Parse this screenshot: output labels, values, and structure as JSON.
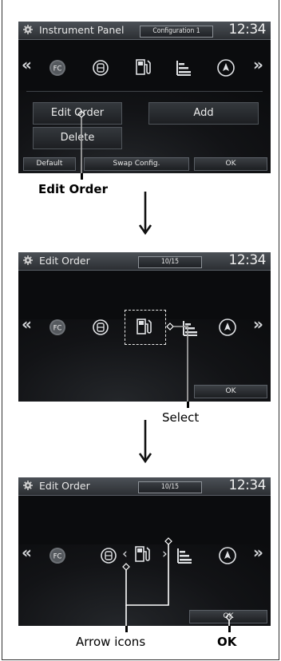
{
  "steps": [
    {
      "screen": {
        "title": "Instrument Panel",
        "config": "Configuration 1",
        "clock": "12:34",
        "buttons": {
          "edit_order": "Edit Order",
          "add": "Add",
          "delete": "Delete",
          "default": "Default",
          "swap": "Swap Config.",
          "ok": "OK"
        },
        "icons": [
          "fuel-economy-icon",
          "tpms-icon",
          "fuel-pump-icon",
          "bar-graph-icon",
          "compass-icon"
        ],
        "fc_label": "FC"
      },
      "caption": "Edit Order"
    },
    {
      "screen": {
        "title": "Edit Order",
        "counter": "10/15",
        "clock": "12:34",
        "ok": "OK",
        "fc_label": "FC"
      },
      "caption": "Select"
    },
    {
      "screen": {
        "title": "Edit Order",
        "counter": "10/15",
        "clock": "12:34",
        "ok": "OK",
        "fc_label": "FC"
      },
      "captions": {
        "arrows": "Arrow icons",
        "ok": "OK"
      }
    }
  ],
  "colors": {
    "screen_bg": "#0b0c0e",
    "topbar": "#3a3e43",
    "text": "#e8e8e8",
    "caption": "#000000"
  }
}
